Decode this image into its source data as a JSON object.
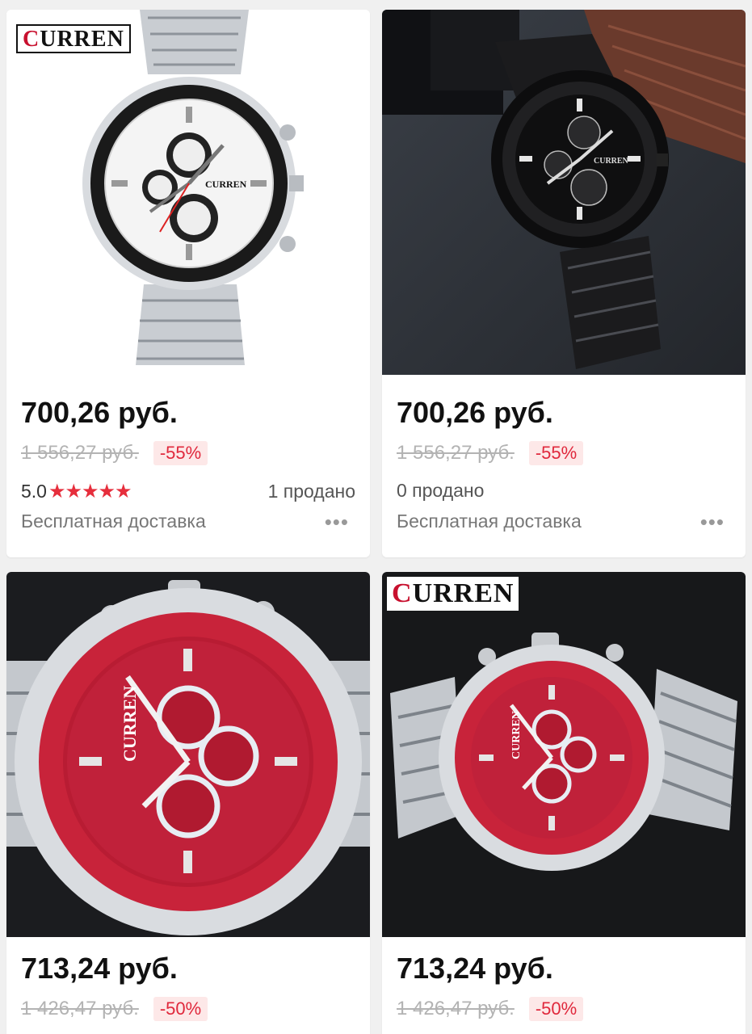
{
  "products": [
    {
      "brand_overlay": "CURREN",
      "price": "700,26 руб.",
      "old_price": "1 556,27 руб.",
      "discount": "-55%",
      "rating": "5.0",
      "stars": "★★★★★",
      "sold": "1 продано",
      "shipping": "Бесплатная доставка",
      "more_icon": "more-dots-icon"
    },
    {
      "price": "700,26 руб.",
      "old_price": "1 556,27 руб.",
      "discount": "-55%",
      "sold": "0 продано",
      "shipping": "Бесплатная доставка",
      "more_icon": "more-dots-icon"
    },
    {
      "price": "713,24 руб.",
      "old_price": "1 426,47 руб.",
      "discount": "-50%"
    },
    {
      "brand_overlay": "CURREN",
      "price": "713,24 руб.",
      "old_price": "1 426,47 руб.",
      "discount": "-50%"
    }
  ],
  "colors": {
    "discount_text": "#e0283c",
    "discount_bg": "#fde8e8",
    "star": "#e62e3c",
    "background": "#f0f0f0"
  }
}
